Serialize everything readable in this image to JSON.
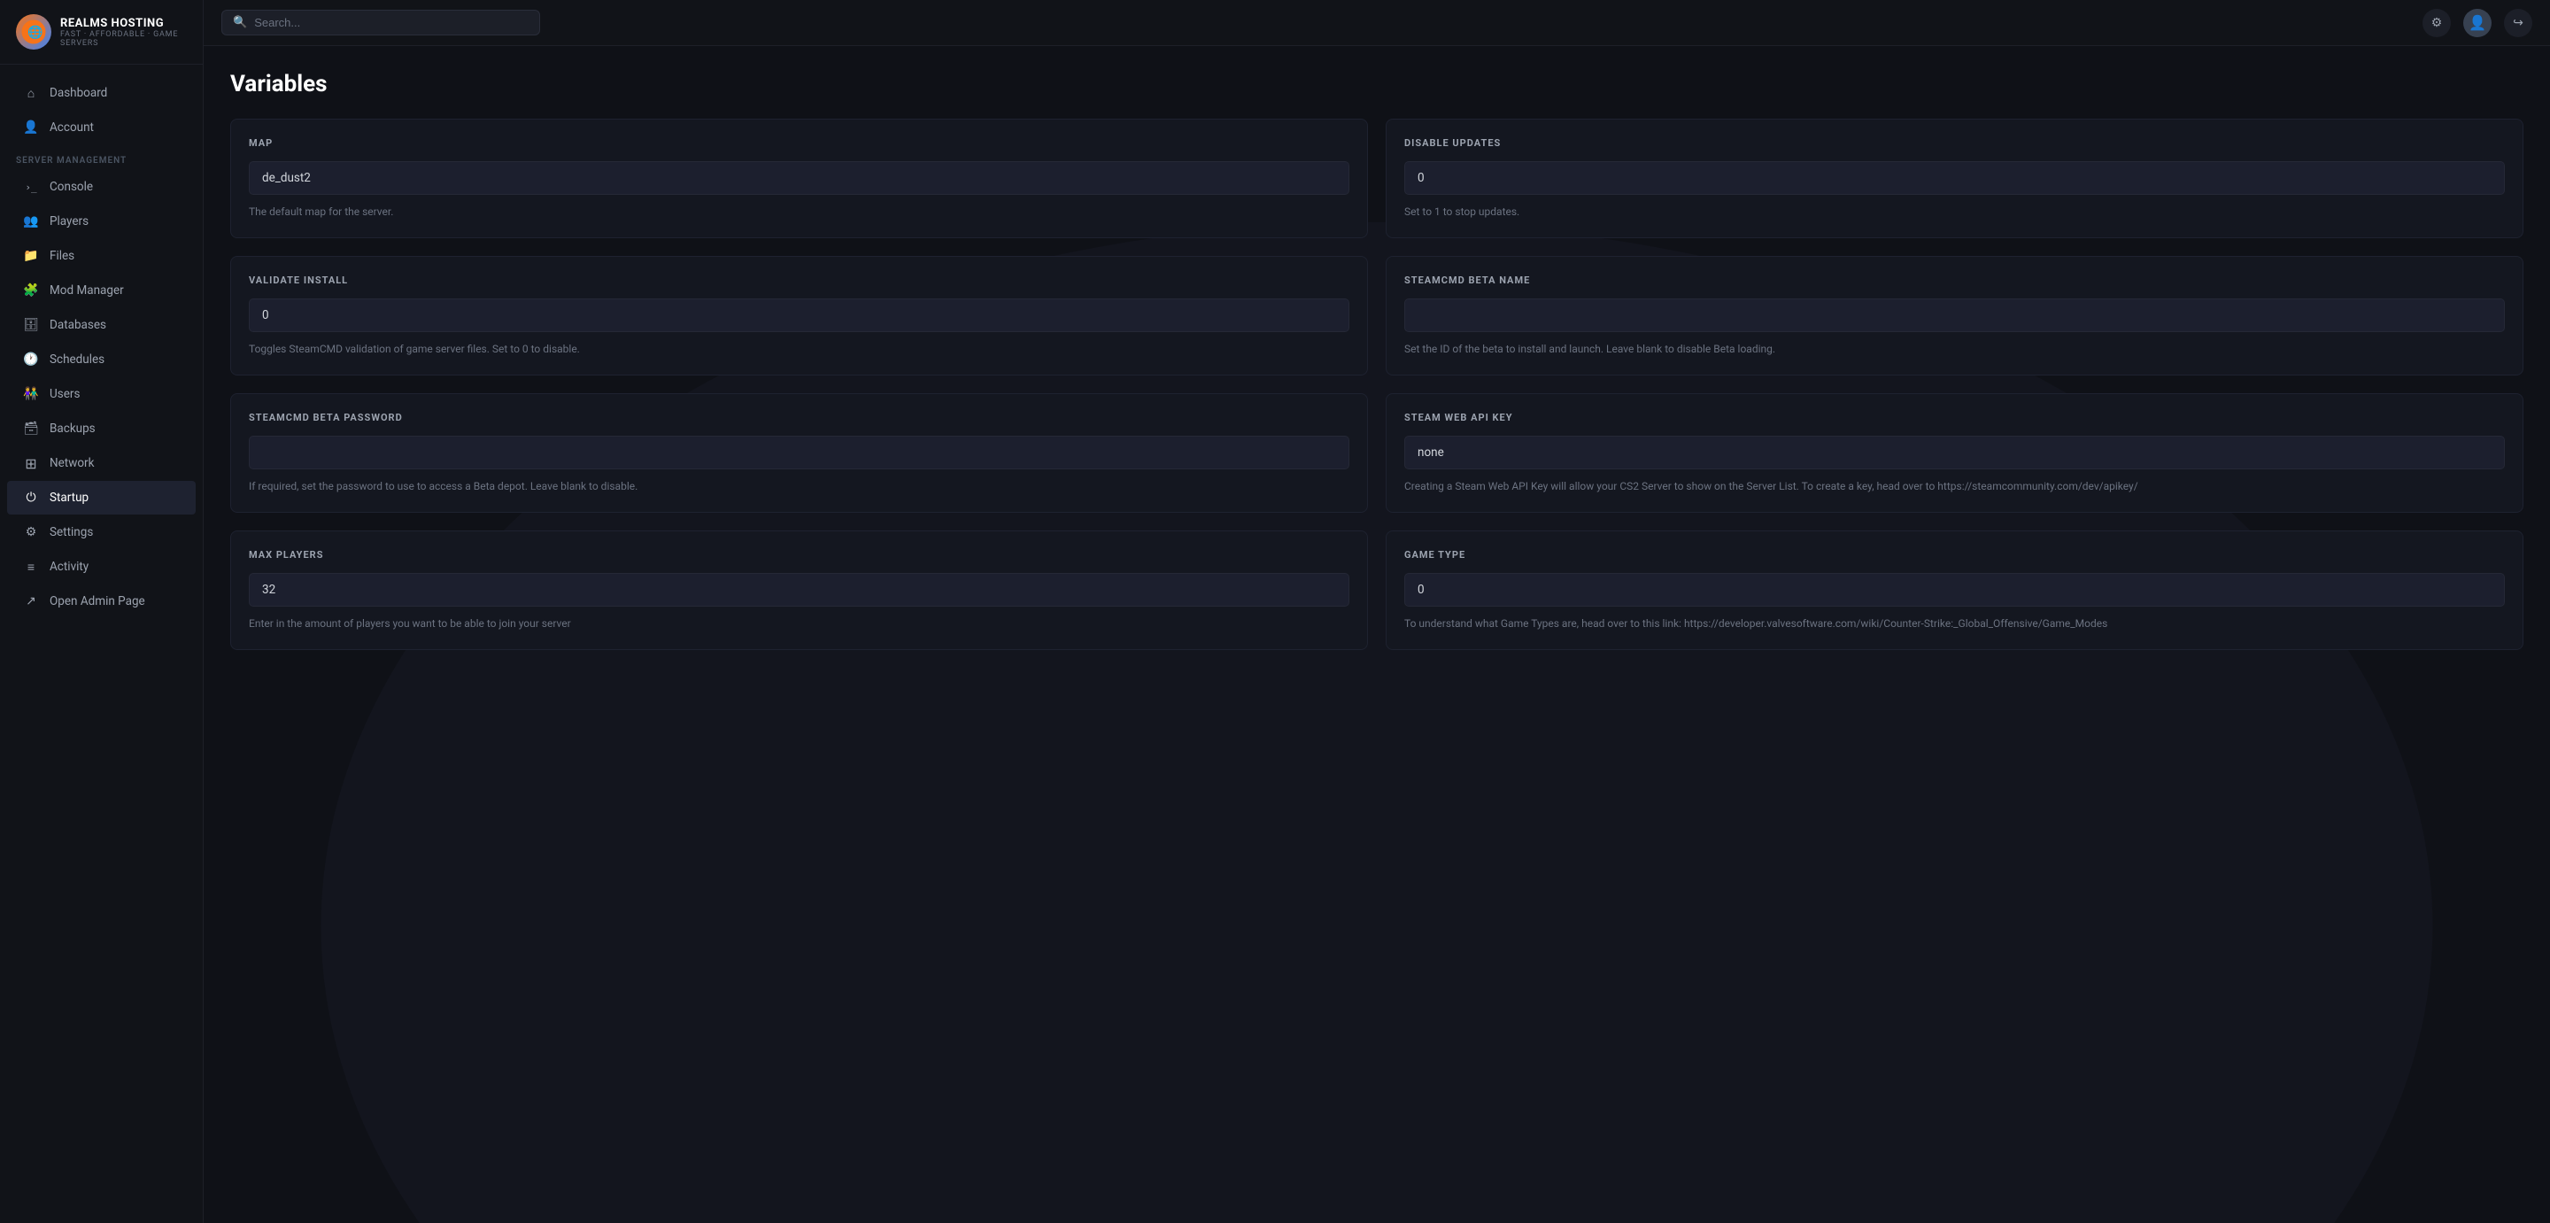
{
  "logo": {
    "title": "REALMS HOSTING",
    "subtitle": "FAST · AFFORDABLE · GAME SERVERS",
    "emoji": "🌐"
  },
  "topbar": {
    "search_placeholder": "Search...",
    "settings_icon": "⚙",
    "avatar_icon": "👤",
    "logout_icon": "↪"
  },
  "sidebar": {
    "top_items": [
      {
        "id": "dashboard",
        "label": "Dashboard",
        "icon": "⌂"
      },
      {
        "id": "account",
        "label": "Account",
        "icon": "👤"
      }
    ],
    "section_label": "SERVER MANAGEMENT",
    "server_items": [
      {
        "id": "console",
        "label": "Console",
        "icon": "›_"
      },
      {
        "id": "players",
        "label": "Players",
        "icon": "👥"
      },
      {
        "id": "files",
        "label": "Files",
        "icon": "📁"
      },
      {
        "id": "mod-manager",
        "label": "Mod Manager",
        "icon": "🧩"
      },
      {
        "id": "databases",
        "label": "Databases",
        "icon": "🗄"
      },
      {
        "id": "schedules",
        "label": "Schedules",
        "icon": "🕐"
      },
      {
        "id": "users",
        "label": "Users",
        "icon": "👫"
      },
      {
        "id": "backups",
        "label": "Backups",
        "icon": "🗃"
      },
      {
        "id": "network",
        "label": "Network",
        "icon": "⊞"
      },
      {
        "id": "startup",
        "label": "Startup",
        "icon": "⏻",
        "active": true
      },
      {
        "id": "settings",
        "label": "Settings",
        "icon": "⚙"
      },
      {
        "id": "activity",
        "label": "Activity",
        "icon": "≡"
      },
      {
        "id": "open-admin",
        "label": "Open Admin Page",
        "icon": "↗"
      }
    ]
  },
  "page": {
    "title": "Variables"
  },
  "variables": [
    {
      "id": "map",
      "label": "MAP",
      "value": "de_dust2",
      "description": "The default map for the server.",
      "placeholder": ""
    },
    {
      "id": "disable-updates",
      "label": "DISABLE UPDATES",
      "value": "0",
      "description": "Set to 1 to stop updates.",
      "placeholder": ""
    },
    {
      "id": "validate-install",
      "label": "VALIDATE INSTALL",
      "value": "0",
      "description": "Toggles SteamCMD validation of game server files. Set to 0 to disable.",
      "placeholder": ""
    },
    {
      "id": "steamcmd-beta-name",
      "label": "STEAMCMD BETA NAME",
      "value": "",
      "description": "Set the ID of the beta to install and launch. Leave blank to disable Beta loading.",
      "placeholder": ""
    },
    {
      "id": "steamcmd-beta-password",
      "label": "STEAMCMD BETA PASSWORD",
      "value": "",
      "description": "If required, set the password to use to access a Beta depot. Leave blank to disable.",
      "placeholder": ""
    },
    {
      "id": "steam-web-api-key",
      "label": "STEAM WEB API KEY",
      "value": "none",
      "description": "Creating a Steam Web API Key will allow your CS2 Server to show on the Server List.  To create a key, head over to https://steamcommunity.com/dev/apikey/",
      "placeholder": ""
    },
    {
      "id": "max-players",
      "label": "MAX PLAYERS",
      "value": "32",
      "description": "Enter in the amount of players you want to be able to join your server",
      "placeholder": ""
    },
    {
      "id": "game-type",
      "label": "GAME TYPE",
      "value": "0",
      "description": "To understand what Game Types are, head over to this link: https://developer.valvesoftware.com/wiki/Counter-Strike:_Global_Offensive/Game_Modes",
      "placeholder": ""
    }
  ]
}
